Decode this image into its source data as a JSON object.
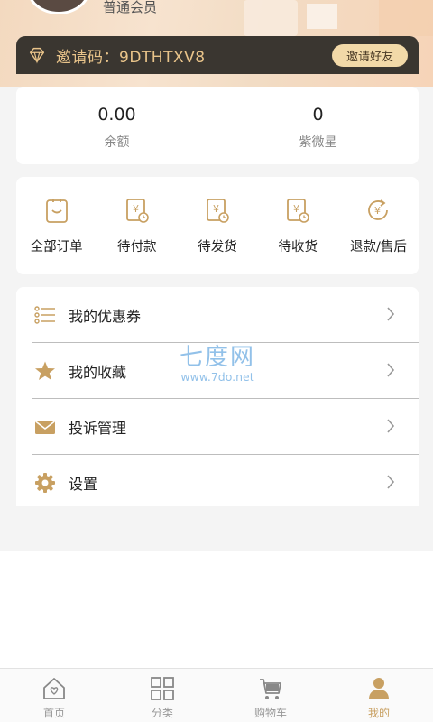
{
  "header": {
    "member_level": "普通会员",
    "invite_code_text": "邀请码：9DTHTXV8",
    "invite_button": "邀请好友"
  },
  "stats": [
    {
      "value": "0.00",
      "label": "余额"
    },
    {
      "value": "0",
      "label": "紫微星"
    }
  ],
  "orders": [
    {
      "label": "全部订单",
      "icon": "all-orders-icon"
    },
    {
      "label": "待付款",
      "icon": "pending-payment-icon"
    },
    {
      "label": "待发货",
      "icon": "pending-shipment-icon"
    },
    {
      "label": "待收货",
      "icon": "pending-receipt-icon"
    },
    {
      "label": "退款/售后",
      "icon": "refund-icon"
    }
  ],
  "menu": [
    {
      "label": "我的优惠券",
      "icon": "list-icon"
    },
    {
      "label": "我的收藏",
      "icon": "star-icon"
    },
    {
      "label": "投诉管理",
      "icon": "envelope-icon"
    },
    {
      "label": "设置",
      "icon": "gear-icon"
    }
  ],
  "watermark": {
    "big": "七度网",
    "small": "www.7do.net"
  },
  "tabs": [
    {
      "label": "首页",
      "icon": "home-icon"
    },
    {
      "label": "分类",
      "icon": "category-icon"
    },
    {
      "label": "购物车",
      "icon": "cart-icon"
    },
    {
      "label": "我的",
      "icon": "profile-icon",
      "active": true
    }
  ],
  "colors": {
    "accent": "#c8a062",
    "invite_bg": "#3a3630",
    "invite_text": "#e9c48a"
  }
}
